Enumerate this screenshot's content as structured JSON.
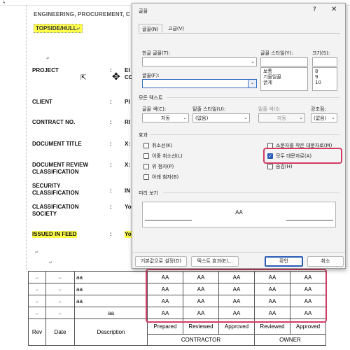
{
  "document": {
    "title": "ENGINEERING, PROCUREMENT, C",
    "subtitle": "TOPSIDE/HULL",
    "fields": [
      {
        "label": "PROJECT",
        "colon": ":",
        "value": "EI\nCO"
      },
      {
        "label": "CLIENT",
        "colon": ":",
        "value": "PI"
      },
      {
        "label": "CONTRACT NO.",
        "colon": ":",
        "value": "RI"
      },
      {
        "label": "DOCUMENT TITLE",
        "colon": ":",
        "value": "X:"
      },
      {
        "label": "DOCUMENT REVIEW\nCLASSIFICATION",
        "colon": ":",
        "value": "X:"
      },
      {
        "label": "SECURITY\nCLASSIFICATION",
        "colon": ":",
        "value": "IN"
      },
      {
        "label": "CLASSIFICATION\nSOCIETY",
        "colon": ":",
        "value": "Yo"
      },
      {
        "label": "ISSUED IN FEED",
        "colon": ":",
        "value": "Yo"
      }
    ],
    "mark_symbol": "↵",
    "table": {
      "rows": [
        {
          "desc": "aa",
          "cells": [
            "AA",
            "AA",
            "AA",
            "AA",
            "AA"
          ]
        },
        {
          "desc": "aa",
          "cells": [
            "AA",
            "AA",
            "AA",
            "AA",
            "AA"
          ]
        },
        {
          "desc": "aa",
          "cells": [
            "AA",
            "AA",
            "AA",
            "AA",
            "AA"
          ]
        },
        {
          "desc": "aa",
          "cells": [
            "AA",
            "AA",
            "AA",
            "AA",
            "AA"
          ]
        }
      ],
      "header": {
        "rev": "Rev",
        "date": "Date",
        "description": "Description",
        "prepared": "Prepared",
        "reviewed": "Reviewed",
        "approved": "Approved",
        "owner_reviewed": "Reviewed",
        "owner_approved": "Approved",
        "contractor": "CONTRACTOR",
        "owner": "OWNER"
      }
    }
  },
  "dialog": {
    "title": "글꼴",
    "help": "?",
    "close": "✕",
    "tabs": [
      "글꼴(N)",
      "고급(V)"
    ],
    "korean_font_label": "한글 글꼴(T):",
    "korean_font_value": "",
    "font_label": "글꼴(F):",
    "font_value": "",
    "style_label": "글꼴 스타일(Y):",
    "style_value": "",
    "style_options": [
      "보통",
      "기울임꼴",
      "굵게"
    ],
    "size_label": "크기(S):",
    "size_value": "",
    "size_options": [
      "8",
      "9",
      "10"
    ],
    "all_text_section": "모든 텍스트",
    "font_color_label": "글꼴 색(C):",
    "font_color_value": "자동",
    "underline_style_label": "밑줄 스타일(U):",
    "underline_style_value": "(없음)",
    "underline_color_label": "밑줄 색(I):",
    "underline_color_value": "자동",
    "emphasis_label": "강조점;",
    "emphasis_value": "(없음)",
    "effects_section": "효과",
    "effects_left": [
      {
        "label": "취소선(K)",
        "checked": false
      },
      {
        "label": "이중 취소선(L)",
        "checked": false
      },
      {
        "label": "위 첨자(P)",
        "checked": false
      },
      {
        "label": "아래 첨자(B)",
        "checked": false
      }
    ],
    "effects_right": [
      {
        "label": "소문자를 작은 대문자로(M)",
        "checked": false
      },
      {
        "label": "모두 대문자로(A)",
        "checked": true
      },
      {
        "label": "숨김(H)",
        "checked": false
      }
    ],
    "preview_section": "미리 보기",
    "preview_text": "AA",
    "btn_default": "기본값으로 설정(D)",
    "btn_effects": "텍스트 효과(E)...",
    "btn_ok": "확인",
    "btn_cancel": "취소"
  },
  "colors": {
    "highlight": "#ffff4a",
    "callout": "#d23c64",
    "checkbox_accent": "#2a5bb8"
  }
}
